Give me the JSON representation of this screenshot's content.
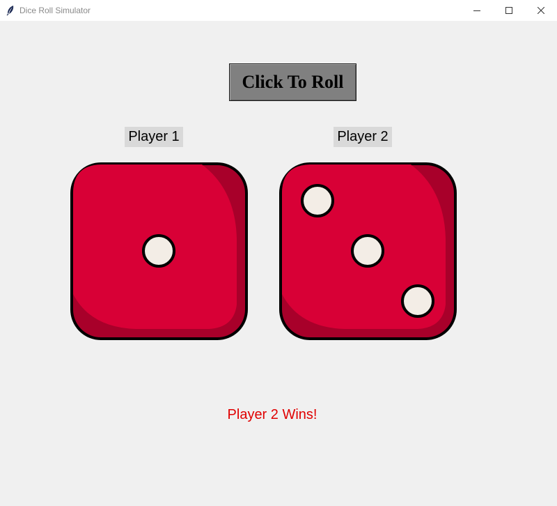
{
  "window": {
    "title": "Dice Roll Simulator",
    "icons": {
      "app": "feather-icon",
      "minimize": "minimize-icon",
      "maximize": "maximize-icon",
      "close": "close-icon"
    }
  },
  "roll_button": {
    "label": "Click To Roll"
  },
  "players": [
    {
      "label": "Player 1",
      "die_value": 1
    },
    {
      "label": "Player 2",
      "die_value": 3
    }
  ],
  "result": {
    "text": "Player 2 Wins!"
  },
  "colors": {
    "background": "#f0f0f0",
    "die_face": "#d80036",
    "die_shadow": "#a8002a",
    "pip": "#f3ede6",
    "result_text": "#e00000",
    "button_bg": "#808080",
    "label_bg": "#d9d9d9"
  }
}
